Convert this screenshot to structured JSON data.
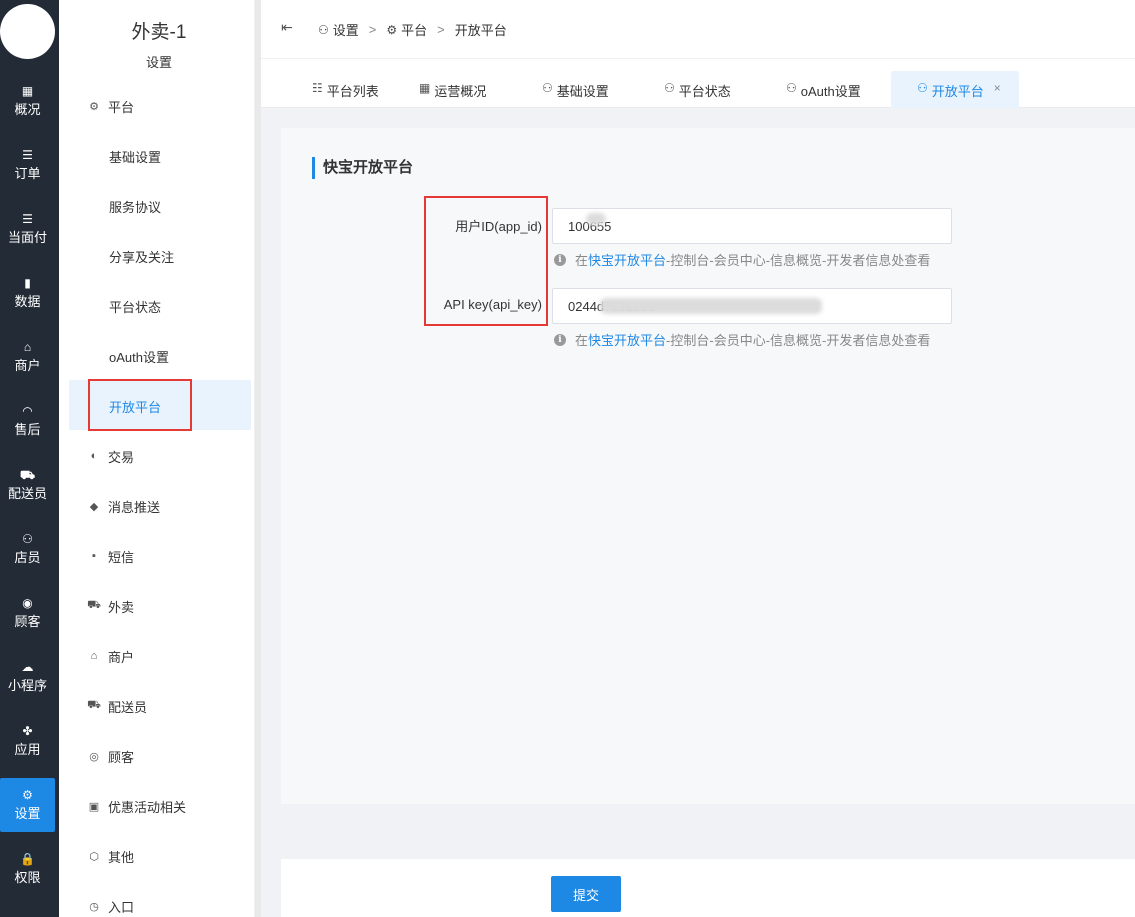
{
  "rail": {
    "items": [
      {
        "label": "概况",
        "icon": "dashboard-icon",
        "glyph": "▦"
      },
      {
        "label": "订单",
        "icon": "order-list-icon",
        "glyph": "☰"
      },
      {
        "label": "当面付",
        "icon": "pay-list-icon",
        "glyph": "☰"
      },
      {
        "label": "数据",
        "icon": "bar-chart-icon",
        "glyph": "▮"
      },
      {
        "label": "商户",
        "icon": "shop-icon",
        "glyph": "⌂"
      },
      {
        "label": "售后",
        "icon": "headset-icon",
        "glyph": "◠"
      },
      {
        "label": "配送员",
        "icon": "scooter-icon",
        "glyph": "⛟"
      },
      {
        "label": "店员",
        "icon": "staff-icon",
        "glyph": "⚇"
      },
      {
        "label": "顾客",
        "icon": "customer-icon",
        "glyph": "◉"
      },
      {
        "label": "小程序",
        "icon": "wechat-icon",
        "glyph": "☁"
      },
      {
        "label": "应用",
        "icon": "apps-icon",
        "glyph": "✤"
      },
      {
        "label": "设置",
        "icon": "settings-user-icon",
        "glyph": "⚙"
      },
      {
        "label": "权限",
        "icon": "lock-icon",
        "glyph": "🔒"
      }
    ],
    "active_index": 11
  },
  "subnav": {
    "title": "外卖-1",
    "subtitle": "设置",
    "platform_group": {
      "label": "平台",
      "chevron": "⌃"
    },
    "platform_items": [
      "基础设置",
      "服务协议",
      "分享及关注",
      "平台状态",
      "oAuth设置",
      "开放平台"
    ],
    "groups": [
      {
        "label": "交易",
        "glyph": "◐"
      },
      {
        "label": "消息推送",
        "glyph": "◆"
      },
      {
        "label": "短信",
        "glyph": "▪"
      },
      {
        "label": "外卖",
        "glyph": "⛟"
      },
      {
        "label": "商户",
        "glyph": "⌂"
      },
      {
        "label": "配送员",
        "glyph": "⛟"
      },
      {
        "label": "顾客",
        "glyph": "◎"
      },
      {
        "label": "优惠活动相关",
        "glyph": "▣"
      },
      {
        "label": "其他",
        "glyph": "⬡"
      },
      {
        "label": "入口",
        "glyph": "◷"
      }
    ],
    "chevron_down": "⌄"
  },
  "topbar": {
    "collapse_glyph": "⇤",
    "breadcrumb": [
      "设置",
      "平台",
      "开放平台"
    ],
    "separator": ">"
  },
  "tabs": [
    {
      "label": "平台列表",
      "glyph": "☷"
    },
    {
      "label": "运营概况",
      "glyph": "▦"
    },
    {
      "label": "基础设置",
      "glyph": "⚇"
    },
    {
      "label": "平台状态",
      "glyph": "⚇"
    },
    {
      "label": "oAuth设置",
      "glyph": "⚇"
    },
    {
      "label": "开放平台",
      "glyph": "⚇",
      "close": "×"
    }
  ],
  "form": {
    "title": "快宝开放平台",
    "fields": [
      {
        "label": "用户ID(app_id)",
        "value": "100655"
      },
      {
        "label": "API key(api_key)",
        "value": "0244d7602e96"
      }
    ],
    "hint": {
      "prefix": "在",
      "link": "快宝开放平台",
      "suffix": "-控制台-会员中心-信息概览-开发者信息处查看"
    },
    "submit_label": "提交"
  }
}
